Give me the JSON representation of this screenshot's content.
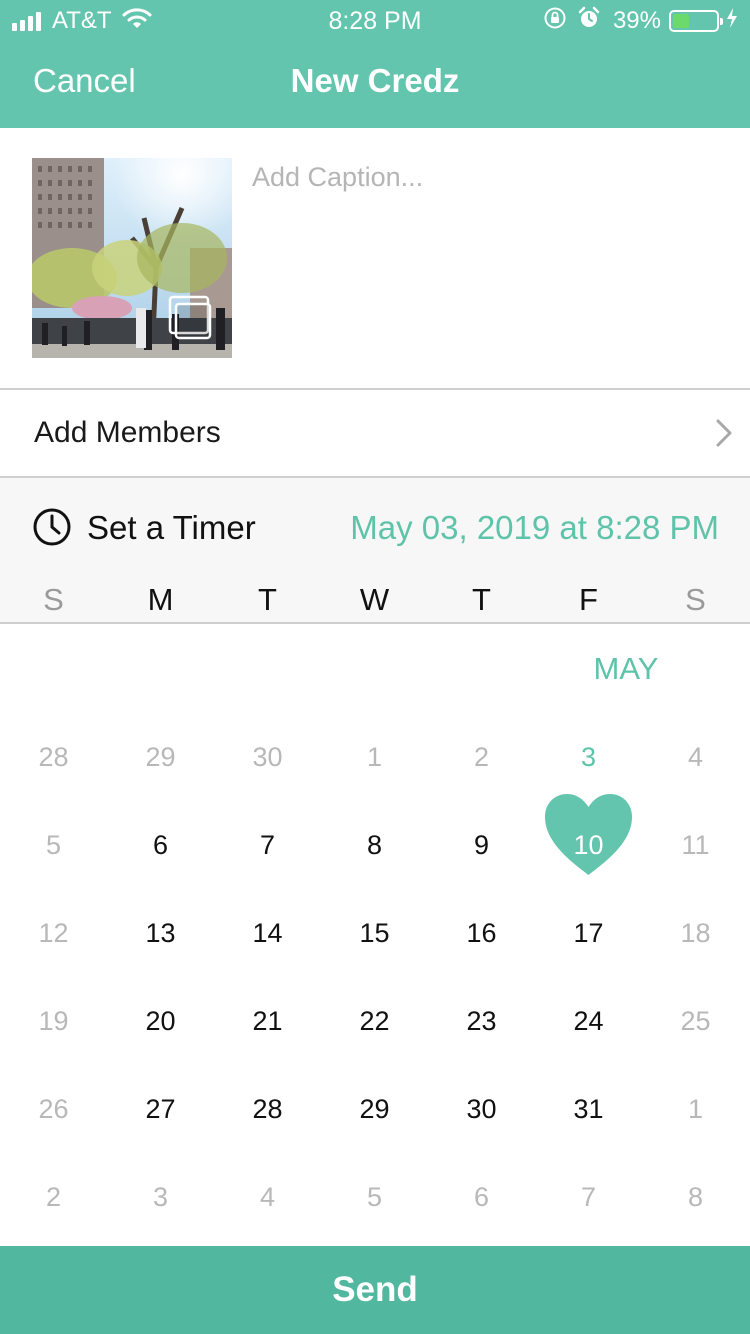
{
  "status_bar": {
    "carrier": "AT&T",
    "time": "8:28 PM",
    "battery": "39%",
    "battery_level": 0.39,
    "icons": [
      "signal-icon",
      "wifi-icon",
      "orientation-lock-icon",
      "alarm-icon",
      "battery-icon",
      "charging-icon"
    ]
  },
  "nav": {
    "cancel_label": "Cancel",
    "title": "New Credz"
  },
  "post": {
    "caption_placeholder": "Add Caption...",
    "caption_value": ""
  },
  "members": {
    "label": "Add Members"
  },
  "timer": {
    "label": "Set a Timer",
    "value": "May 03, 2019 at 8:28 PM"
  },
  "colors": {
    "accent": "#63c5ad",
    "accent_text": "#5fc3aa",
    "send_bg": "#51b79e",
    "muted_text": "#b8b8b8"
  },
  "calendar": {
    "weekdays": [
      "S",
      "M",
      "T",
      "W",
      "T",
      "F",
      "S"
    ],
    "month": "MAY",
    "weeks": [
      [
        "28",
        "29",
        "30",
        "1",
        "2",
        "3",
        "4"
      ],
      [
        "5",
        "6",
        "7",
        "8",
        "9",
        "10",
        "11"
      ],
      [
        "12",
        "13",
        "14",
        "15",
        "16",
        "17",
        "18"
      ],
      [
        "19",
        "20",
        "21",
        "22",
        "23",
        "24",
        "25"
      ],
      [
        "26",
        "27",
        "28",
        "29",
        "30",
        "31",
        "1"
      ],
      [
        "2",
        "3",
        "4",
        "5",
        "6",
        "7",
        "8"
      ]
    ],
    "muted_cells": [
      [
        0,
        0
      ],
      [
        0,
        1
      ],
      [
        0,
        2
      ],
      [
        0,
        3
      ],
      [
        0,
        4
      ],
      [
        0,
        6
      ],
      [
        1,
        0
      ],
      [
        1,
        6
      ],
      [
        2,
        0
      ],
      [
        2,
        6
      ],
      [
        3,
        0
      ],
      [
        3,
        6
      ],
      [
        4,
        0
      ],
      [
        4,
        6
      ],
      [
        5,
        0
      ],
      [
        5,
        1
      ],
      [
        5,
        2
      ],
      [
        5,
        3
      ],
      [
        5,
        4
      ],
      [
        5,
        5
      ],
      [
        5,
        6
      ]
    ],
    "today_cell": [
      0,
      5
    ],
    "selected_cell": [
      1,
      5
    ]
  },
  "send_label": "Send"
}
